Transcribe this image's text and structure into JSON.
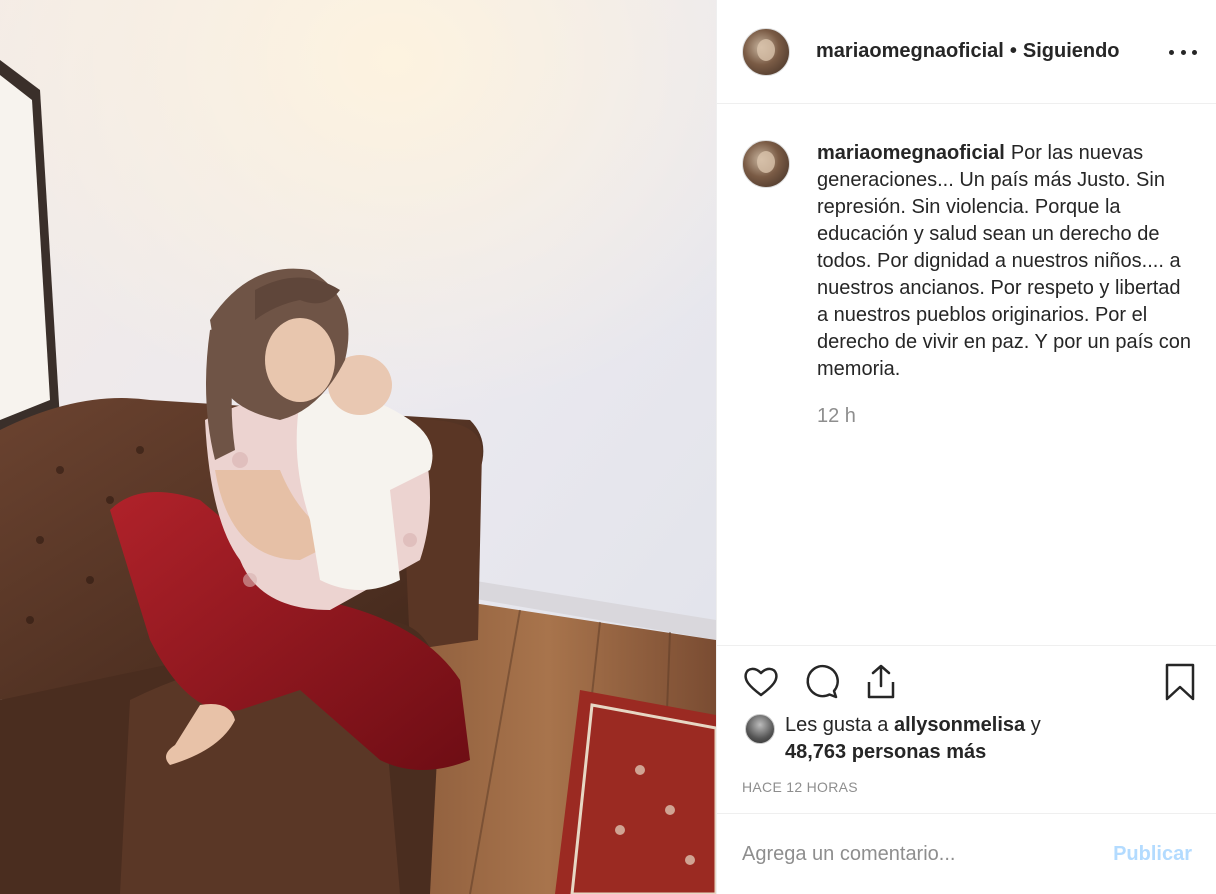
{
  "post": {
    "username": "mariaomegnaoficial",
    "separator": "•",
    "follow_status": "Siguiendo",
    "photo_alt": "",
    "caption": "Por las nuevas generaciones... Un país más Justo. Sin represión. Sin violencia. Porque la educación y salud sean un derecho de todos. Por dignidad a nuestros niños.... a nuestros ancianos. Por respeto y libertad a nuestros pueblos originarios. Por el derecho de vivir en paz. Y por un país con memoria.",
    "relative_time": "12 h",
    "likes_prefix": "Les gusta a",
    "liked_by": "allysonmelisa",
    "likes_connector": "y",
    "likes_others": "48,763 personas más",
    "timestamp": "HACE 12 HORAS"
  },
  "comment": {
    "placeholder": "Agrega un comentario...",
    "post_label": "Publicar"
  },
  "icons": {
    "more": "more-options-icon",
    "like": "heart-icon",
    "comment": "comment-icon",
    "share": "share-icon",
    "save": "bookmark-icon"
  },
  "colors": {
    "text": "#262626",
    "muted": "#8e8e8e",
    "border": "#efefef",
    "post_button_disabled": "#b3dbff"
  }
}
